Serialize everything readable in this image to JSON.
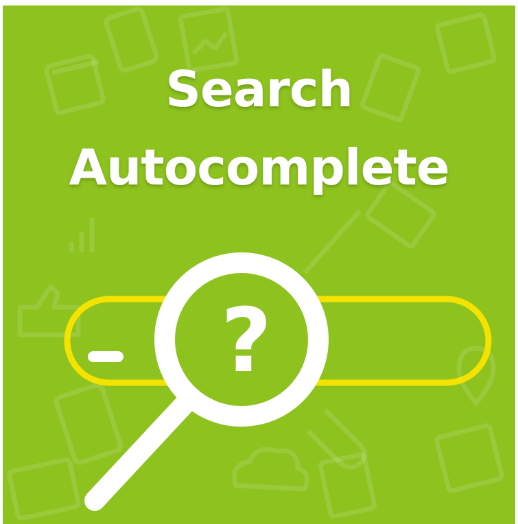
{
  "title": {
    "line1": "Search",
    "line2": "Autocomplete"
  },
  "illustration": {
    "search_field_cursor": "_",
    "magnifier_symbol": "?"
  },
  "colors": {
    "background": "#8dc21f",
    "field_outline": "#f4e200",
    "foreground": "#ffffff"
  },
  "icons": [
    "search-field-icon",
    "magnifying-glass-icon",
    "question-mark-icon",
    "cursor-icon"
  ]
}
